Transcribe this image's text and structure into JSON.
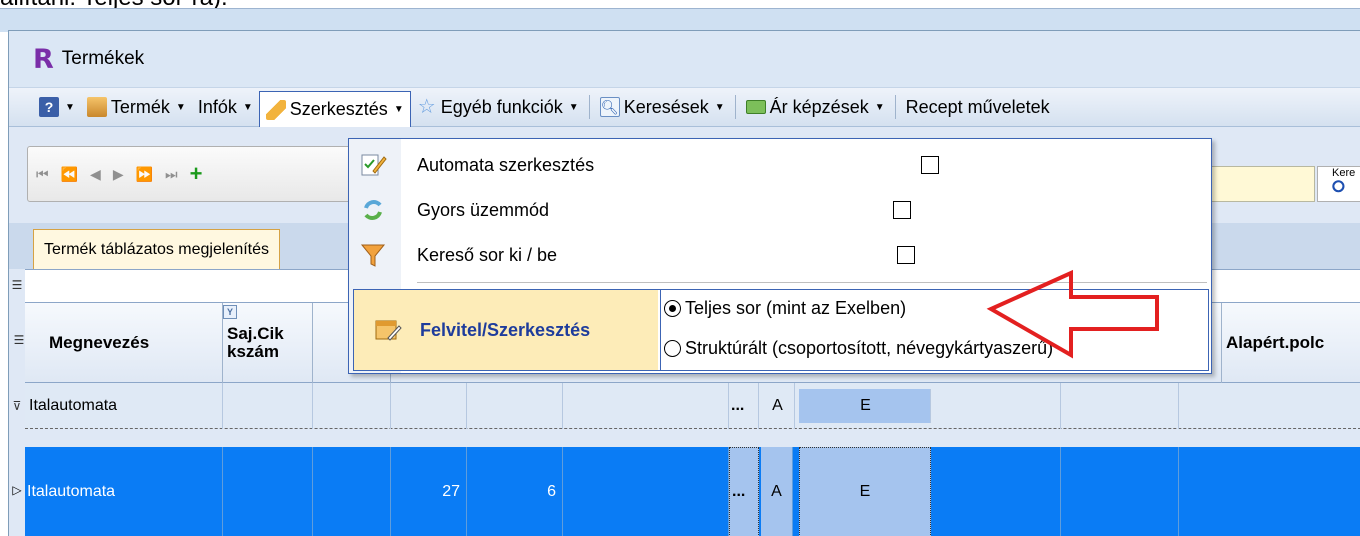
{
  "doc_text": "állítani: Teljes sor-ra).",
  "window": {
    "logo": "R",
    "title": "Termékek"
  },
  "menubar": {
    "items": [
      {
        "label": "Termék"
      },
      {
        "label": "Infók"
      },
      {
        "label": "Szerkesztés"
      },
      {
        "label": "Egyéb funkciók"
      },
      {
        "label": "Keresések"
      },
      {
        "label": "Ár képzések"
      },
      {
        "label": "Recept műveletek"
      }
    ]
  },
  "toolbar": {
    "kereso_label": "Kere"
  },
  "tab": {
    "label": "Termék táblázatos megjelenítés"
  },
  "dropdown": {
    "items": [
      {
        "label": "Automata szerkesztés",
        "checked": false
      },
      {
        "label": "Gyors üzemmód",
        "checked": false
      },
      {
        "label": "Kereső sor ki / be",
        "checked": false
      }
    ],
    "submenu": {
      "label": "Felvitel/Szerkesztés",
      "options": [
        {
          "label": "Teljes sor (mint az Exelben)",
          "selected": true
        },
        {
          "label": "Struktúrált (csoportosított, névegykártyaszerű)",
          "selected": false
        }
      ]
    }
  },
  "grid": {
    "headers": {
      "megnevezes": "Megnevezés",
      "sajcik_line1": "Saj.Cik",
      "sajcik_line2": "kszám",
      "alapert": "Alapért.polc"
    },
    "filter_row": {
      "name": "Italautomata",
      "dots": "...",
      "a": "A",
      "e": "E"
    },
    "data_row": {
      "name": "Italautomata",
      "v1": "27",
      "v2": "6",
      "dots": "...",
      "a": "A",
      "e": "E"
    }
  },
  "colors": {
    "selection": "#0a7cf5",
    "submenu_highlight": "#fdecb8",
    "annotation_arrow": "#e32020"
  }
}
